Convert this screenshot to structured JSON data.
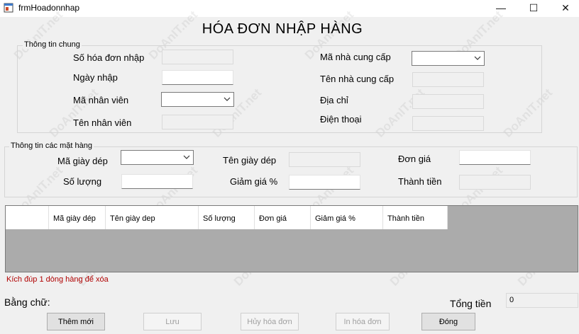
{
  "window": {
    "title": "frmHoadonnhap",
    "minimize_glyph": "—",
    "maximize_glyph": "☐",
    "close_glyph": "✕"
  },
  "form": {
    "heading": "HÓA ĐƠN NHẬP HÀNG"
  },
  "general_group": {
    "label": "Thông tin  chung",
    "so_hoa_don_label": "Số hóa đơn nhập",
    "so_hoa_don_value": "",
    "ngay_nhap_label": "Ngày nhập",
    "ngay_nhap_value": "",
    "ma_nhan_vien_label": "Mã nhân viên",
    "ma_nhan_vien_value": "",
    "ten_nhan_vien_label": "Tên nhân viên",
    "ten_nhan_vien_value": "",
    "ma_ncc_label": "Mã nhà cung cấp",
    "ma_ncc_value": "",
    "ten_ncc_label": "Tên nhà cung cấp",
    "ten_ncc_value": "",
    "dia_chi_label": "Địa chỉ",
    "dia_chi_value": "",
    "dien_thoai_label": "Điện thoại",
    "dien_thoai_value": ""
  },
  "items_group": {
    "label": "Thông tin các mặt hàng",
    "ma_giay_label": "Mã giày dép",
    "ma_giay_value": "",
    "ten_giay_label": "Tên giày dép",
    "ten_giay_value": "",
    "don_gia_label": "Đơn giá",
    "don_gia_value": "",
    "so_luong_label": "Số lượng",
    "so_luong_value": "",
    "giam_gia_label": "Giảm giá %",
    "giam_gia_value": "",
    "thanh_tien_label": "Thành tiền",
    "thanh_tien_value": ""
  },
  "grid": {
    "columns": [
      "Mã giày dép",
      "Tên giày dep",
      "Số lượng",
      "Đơn giá",
      "Giảm giá %",
      "Thành tiền"
    ]
  },
  "hint": "Kích đúp 1 dòng hàng để xóa",
  "footer": {
    "bang_chu_label": "Bằng chữ:",
    "tong_tien_label": "Tổng tiền",
    "tong_tien_value": "0"
  },
  "buttons": {
    "them_moi": "Thêm mới",
    "luu": "Lưu",
    "huy": "Hủy hóa đơn",
    "in": "In hóa đơn",
    "dong": "Đóng"
  },
  "watermark": "DoAnIT.net"
}
